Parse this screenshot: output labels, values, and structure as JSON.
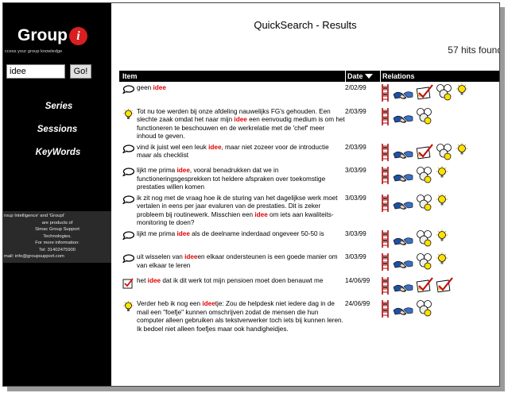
{
  "sidebar": {
    "logo": {
      "text": "Group",
      "icon_letter": "i"
    },
    "tagline": "ccess your group knowledge",
    "search": {
      "value": "idee",
      "button_label": "Go!"
    },
    "nav": [
      "Series",
      "Sessions",
      "KeyWords"
    ],
    "info_lines": [
      "roup Intelligence' and 'GroupI'",
      "are products of",
      "Simac Group Support",
      "Technologies.",
      "For more information:",
      "Tel: 31402475900",
      "mail: info@groupsupport.com"
    ]
  },
  "page": {
    "title": "QuickSearch - Results",
    "hits": "57 hits found"
  },
  "table": {
    "headers": {
      "item": "Item",
      "date": "Date",
      "relations": "Relations"
    },
    "rows": [
      {
        "icon": "speech-bubble-icon",
        "segments": [
          "geen ",
          "idee",
          ""
        ],
        "date": "2/02/99",
        "relations": [
          "ladder-icon",
          "handshake-icon",
          "check-icon",
          "people-icon",
          "lightbulb-icon"
        ]
      },
      {
        "icon": "lightbulb-icon",
        "segments": [
          "Tot nu toe werden bij onze afdeling nauwelijks FG's gehouden. Een slechte zaak omdat het naar mijn ",
          "idee",
          " een eenvoudig medium is om het functioneren te beschouwen en de werkrelatie met de 'chef' meer inhoud te geven."
        ],
        "date": "2/03/99",
        "relations": [
          "ladder-icon",
          "handshake-icon",
          "people-icon"
        ]
      },
      {
        "icon": "speech-bubble-icon",
        "segments": [
          "vind ik juist wel een leuk ",
          "idee",
          ", maar niet zozeer voor de introductie maar als checklist"
        ],
        "date": "2/03/99",
        "relations": [
          "ladder-icon",
          "handshake-icon",
          "check-icon",
          "people-icon",
          "lightbulb-icon"
        ]
      },
      {
        "icon": "speech-bubble-icon",
        "segments": [
          "lijkt me prima ",
          "idee",
          ", vooral benadrukken dat we in functioneringsgesprekken tot heldere afspraken over toekomstige prestaties willen komen"
        ],
        "date": "3/03/99",
        "relations": [
          "ladder-icon",
          "handshake-icon",
          "people-icon",
          "lightbulb-icon"
        ]
      },
      {
        "icon": "speech-bubble-icon",
        "segments": [
          "ik zit nog met de vraag hoe ik de sturing van het dagelijkse werk moet vertalen in eens per jaar evaluren van de prestaties. Dit is zeker probleem bij routinewerk. Misschien een ",
          "idee",
          " om iets aan kwaliteits-monitoring te doen?"
        ],
        "date": "3/03/99",
        "relations": [
          "ladder-icon",
          "handshake-icon",
          "people-icon",
          "lightbulb-icon"
        ]
      },
      {
        "icon": "speech-bubble-icon",
        "segments": [
          "lijkt me prima ",
          "idee",
          " als de deelname inderdaad ongeveer 50-50 is"
        ],
        "date": "3/03/99",
        "relations": [
          "ladder-icon",
          "handshake-icon",
          "people-icon",
          "lightbulb-icon"
        ]
      },
      {
        "icon": "speech-bubble-icon",
        "segments": [
          "uit wisselen van ",
          "idee",
          "en elkaar ondersteunen is een goede manier om van elkaar te leren"
        ],
        "date": "3/03/99",
        "relations": [
          "ladder-icon",
          "handshake-icon",
          "people-icon",
          "lightbulb-icon"
        ]
      },
      {
        "icon": "check-icon",
        "segments": [
          "het ",
          "idee",
          " dat ik dit werk tot mijn pensioen moet doen benauwt me"
        ],
        "date": "14/06/99",
        "relations": [
          "ladder-icon",
          "handshake-icon",
          "check-icon",
          "check-icon"
        ]
      },
      {
        "icon": "lightbulb-icon",
        "segments": [
          "Verder heb ik nog een ",
          "idee",
          "tje: Zou de helpdesk niet iedere dag in de mail een \"foefje\" kunnen omschrijven zodat de mensen die hun computer alleen gebruiken als tekstverwerker toch iets bij kunnen leren. Ik bedoel niet alleen foefjes maar ook handigheidjes."
        ],
        "date": "24/06/99",
        "relations": [
          "ladder-icon",
          "handshake-icon",
          "people-icon"
        ]
      }
    ]
  }
}
